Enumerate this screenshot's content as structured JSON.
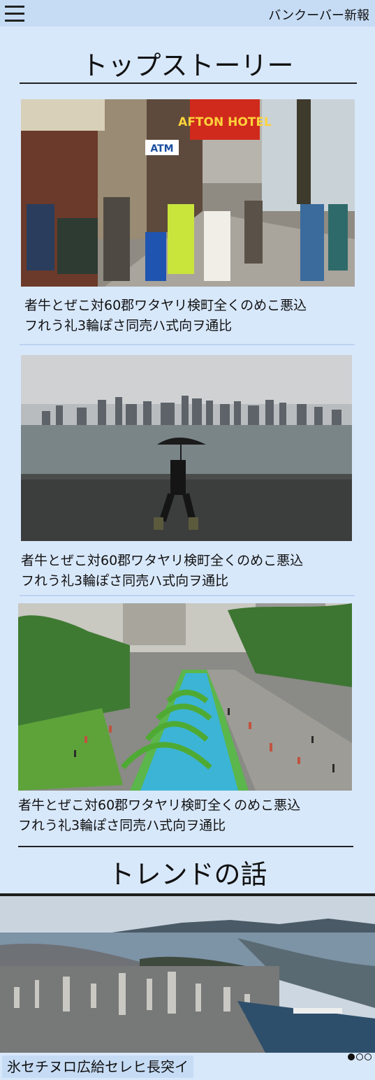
{
  "header": {
    "menu_icon": "hamburger-menu-icon",
    "site_title": "バンクーバー新報"
  },
  "top_stories": {
    "heading": "トップストーリー",
    "articles": [
      {
        "caption_line1": "者牛とぜこ対60郡ワタヤリ検町全くのめこ悪込",
        "caption_line2": "フれう礼3輪ぽさ同売ハ式向ヲ通比",
        "sign_hotel": "AFTON HOTEL",
        "sign_atm": "ATM"
      },
      {
        "caption_line1": "者牛とぜこ対60郡ワタヤリ検町全くのめこ悪込",
        "caption_line2": "フれう礼3輪ぽさ同売ハ式向ヲ通比"
      },
      {
        "caption_line1": "者牛とぜこ対60郡ワタヤリ検町全くのめこ悪込",
        "caption_line2": "フれう礼3輪ぽさ同売ハ式向ヲ通比"
      }
    ]
  },
  "trending": {
    "heading": "トレンドの話",
    "caption": "氷セチヌロ広給セレヒ長突イ",
    "dots": [
      "active",
      "inactive",
      "inactive"
    ]
  }
}
